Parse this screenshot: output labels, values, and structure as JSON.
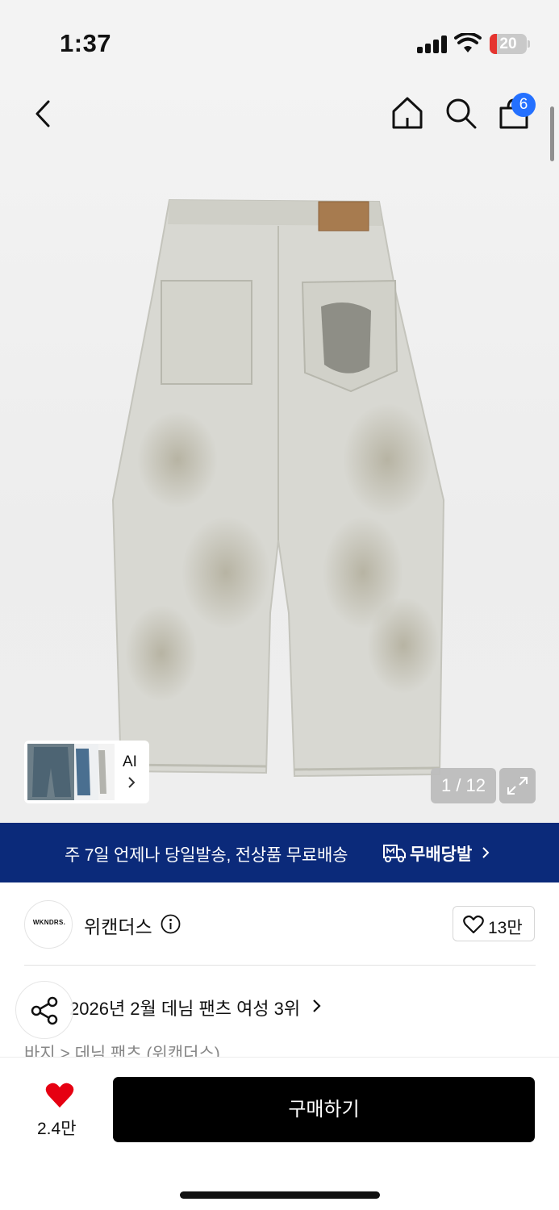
{
  "status_bar": {
    "time": "1:37",
    "battery": "20",
    "battery_level": 0.2
  },
  "header": {
    "cart_count": "6"
  },
  "gallery": {
    "ai_label": "AI",
    "page_counter": "1 / 12"
  },
  "delivery_banner": {
    "text": "주 7일 언제나 당일발송, 전상품 무료배송",
    "brand": "무배당발",
    "color": "#0b2a7a"
  },
  "brand": {
    "logo_text": "WKNDRS.",
    "name": "위캔더스",
    "likes": "13만"
  },
  "ranking": {
    "text": "2026년 2월 데님 팬츠 여성 3위",
    "category": "바지 > 데님 팬츠 (위캔더스)"
  },
  "bottom_bar": {
    "wish_count": "2.4만",
    "buy_label": "구매하기",
    "wish_color": "#e60012"
  },
  "icons": [
    "back-icon",
    "home-icon",
    "search-icon",
    "cart-icon",
    "chevron-right-icon",
    "expand-icon",
    "info-icon",
    "heart-icon",
    "share-icon",
    "truck-icon"
  ]
}
